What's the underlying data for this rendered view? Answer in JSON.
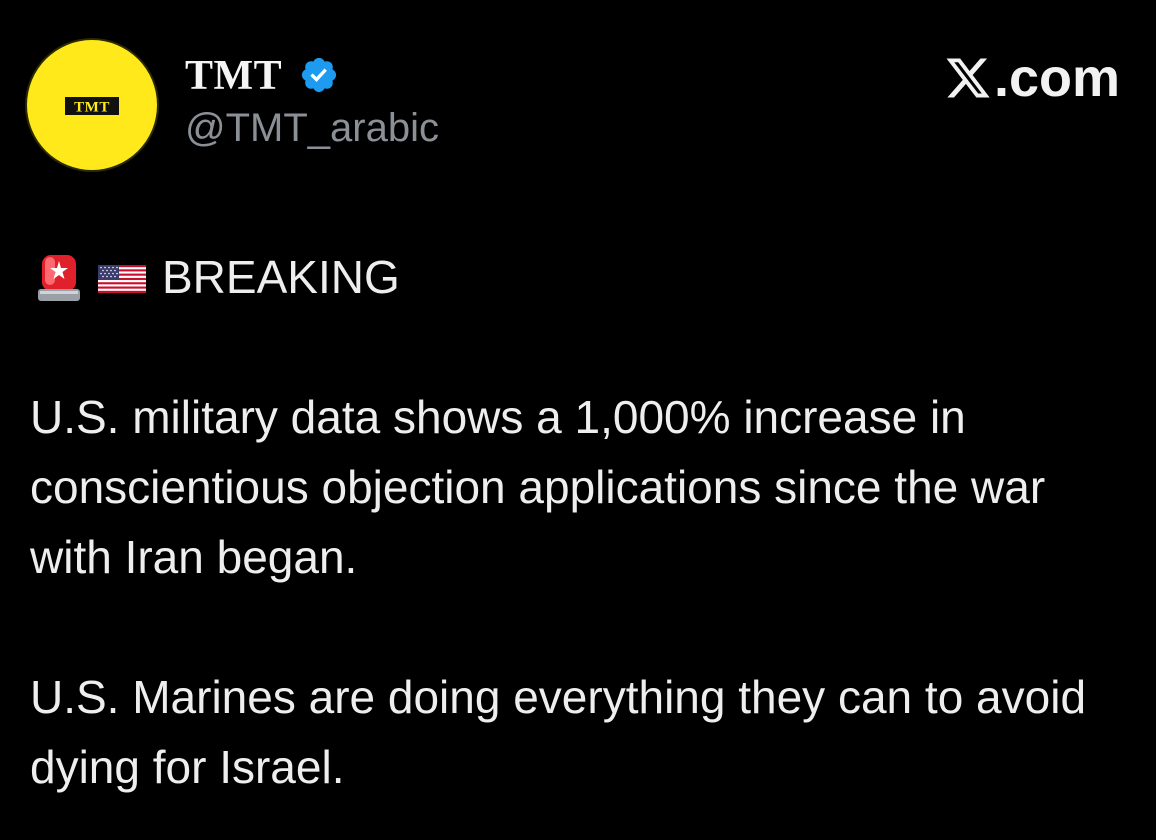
{
  "post": {
    "author": {
      "display_name": "TMT",
      "handle": "@TMT_arabic",
      "avatar_text": "TMT",
      "avatar_color": "#ffe91a",
      "verified": true,
      "verified_color": "#1d9bf0"
    },
    "brand": {
      "logo_icon": "x-logo-icon",
      "text": ".com"
    },
    "breaking": {
      "siren_icon": "rotating-light-icon",
      "flag_icon": "us-flag-icon",
      "label": "BREAKING"
    },
    "paragraphs": [
      "U.S. military data shows a 1,000% increase in conscientious objection applications since the war with Iran began.",
      "U.S. Marines are doing everything they can to avoid dying for Israel."
    ]
  },
  "colors": {
    "background": "#000000",
    "text": "#e7e9ea",
    "handle": "#8b9096"
  }
}
